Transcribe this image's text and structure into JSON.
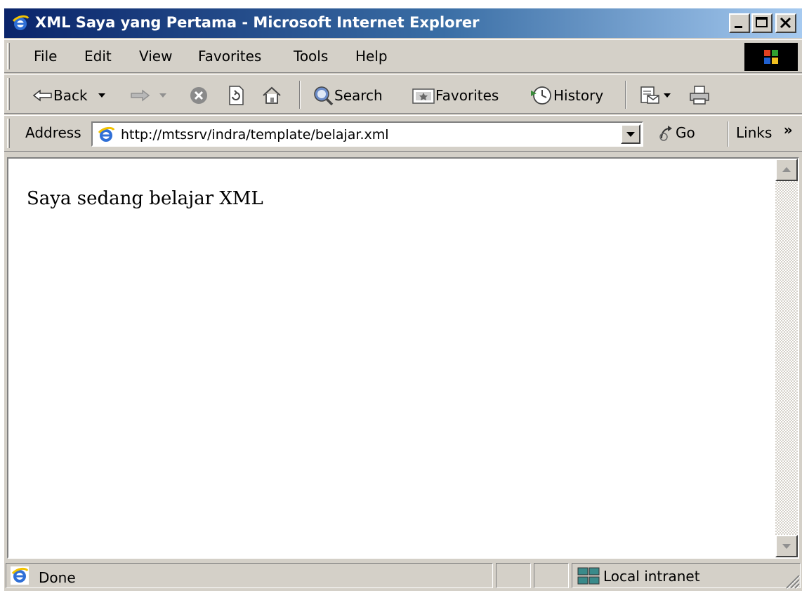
{
  "window": {
    "title": "XML Saya yang Pertama - Microsoft Internet Explorer",
    "caption_buttons": {
      "minimize": "minimize-icon",
      "maximize": "maximize-icon",
      "close": "close-icon"
    }
  },
  "menu": {
    "items": [
      {
        "label": "File"
      },
      {
        "label": "Edit"
      },
      {
        "label": "View"
      },
      {
        "label": "Favorites"
      },
      {
        "label": "Tools"
      },
      {
        "label": "Help"
      }
    ]
  },
  "toolbar": {
    "back_label": "Back",
    "search_label": "Search",
    "favorites_label": "Favorites",
    "history_label": "History"
  },
  "address": {
    "label": "Address",
    "url": "http://mtssrv/indra/template/belajar.xml",
    "go_label": "Go",
    "links_label": "Links",
    "links_chevron": "»"
  },
  "page": {
    "body_text": "Saya sedang belajar XML"
  },
  "status": {
    "text": "Done",
    "zone": "Local intranet"
  },
  "colors": {
    "titlebar_start": "#0a246a",
    "titlebar_end": "#a6caf0",
    "chrome": "#d4d0c8"
  }
}
